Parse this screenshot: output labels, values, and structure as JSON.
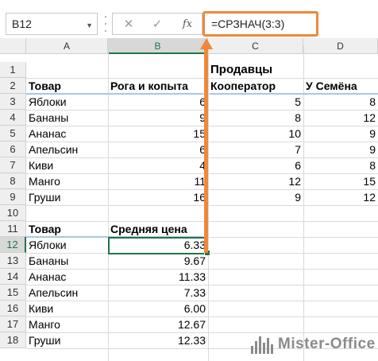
{
  "formula_bar": {
    "name_box": "B12",
    "cancel_icon": "✕",
    "enter_icon": "✓",
    "fx_label": "fx",
    "formula": "=СРЗНАЧ(3:3)"
  },
  "columns": [
    "A",
    "B",
    "C",
    "D"
  ],
  "rows": [
    "1",
    "2",
    "3",
    "4",
    "5",
    "6",
    "7",
    "8",
    "9",
    "10",
    "11",
    "12",
    "13",
    "14",
    "15",
    "16",
    "17",
    "18"
  ],
  "sheet": {
    "c1": "Продавцы",
    "header_row": [
      "Товар",
      "Рога и копыта",
      "Кооператор",
      "У Семёна"
    ],
    "table1": [
      [
        "Яблоки",
        "6",
        "5",
        "8"
      ],
      [
        "Бананы",
        "9",
        "8",
        "12"
      ],
      [
        "Ананас",
        "15",
        "10",
        "9"
      ],
      [
        "Апельсин",
        "6",
        "7",
        "9"
      ],
      [
        "Киви",
        "4",
        "6",
        "8"
      ],
      [
        "Манго",
        "11",
        "12",
        "15"
      ],
      [
        "Груши",
        "16",
        "9",
        "12"
      ]
    ],
    "header2": [
      "Товар",
      "Средняя цена"
    ],
    "table2": [
      [
        "Яблоки",
        "6.33"
      ],
      [
        "Бананы",
        "9.67"
      ],
      [
        "Ананас",
        "11.33"
      ],
      [
        "Апельсин",
        "7.33"
      ],
      [
        "Киви",
        "6.00"
      ],
      [
        "Манго",
        "12.67"
      ],
      [
        "Груши",
        "12.33"
      ]
    ]
  },
  "logo_text": "Mister-Office",
  "colors": {
    "accent_orange": "#f0883a",
    "excel_green": "#217346",
    "header_blue_line": "#a9c6e8"
  }
}
